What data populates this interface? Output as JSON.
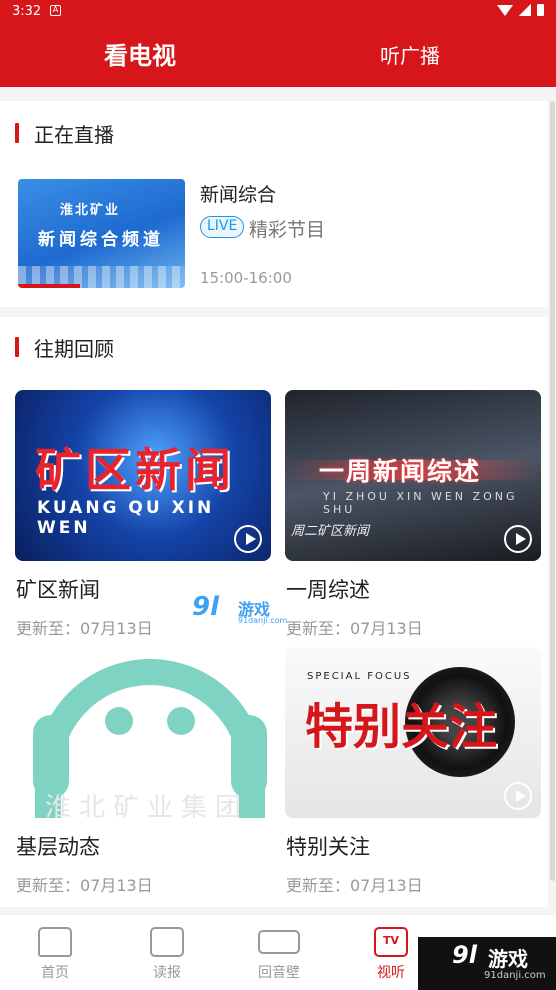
{
  "status_bar": {
    "time": "3:32",
    "notification_icon": "A"
  },
  "header": {
    "tabs": [
      {
        "label": "看电视",
        "active": true
      },
      {
        "label": "听广播",
        "active": false
      }
    ]
  },
  "live_section": {
    "title": "正在直播",
    "item": {
      "name": "新闻综合",
      "badge": "LIVE",
      "program": "精彩节目",
      "time": "15:00-16:00",
      "thumb": {
        "brand": "淮北矿业",
        "channel": "新闻综合频道"
      }
    }
  },
  "archive_section": {
    "title": "往期回顾",
    "items": [
      {
        "title": "矿区新闻",
        "update": "更新至：07月13日",
        "thumb_text": "矿区新闻",
        "thumb_pinyin": "KUANG QU XIN WEN"
      },
      {
        "title": "一周综述",
        "update": "更新至：07月13日",
        "thumb_text": "一周新闻综述",
        "thumb_pinyin": "YI ZHOU XIN WEN ZONG SHU",
        "thumb_sub": "周二矿区新闻"
      },
      {
        "title": "基层动态",
        "update": "更新至：07月13日",
        "thumb_text": "淮北矿业集团"
      },
      {
        "title": "特别关注",
        "update": "更新至：07月13日",
        "thumb_text": "特别关注",
        "thumb_pinyin": "SPECIAL FOCUS"
      }
    ]
  },
  "bottom_nav": {
    "items": [
      {
        "label": "首页",
        "icon": "home-icon",
        "active": false
      },
      {
        "label": "读报",
        "icon": "newspaper-icon",
        "active": false
      },
      {
        "label": "回音壁",
        "icon": "scroll-icon",
        "active": false
      },
      {
        "label": "视听",
        "icon": "tv-icon",
        "active": true,
        "icon_text": "TV"
      }
    ]
  },
  "watermark": {
    "logo": "9l",
    "name": "游戏",
    "domain": "91danji.com"
  },
  "colors": {
    "brand_red": "#d6161b",
    "live_blue": "#1a96e8"
  }
}
